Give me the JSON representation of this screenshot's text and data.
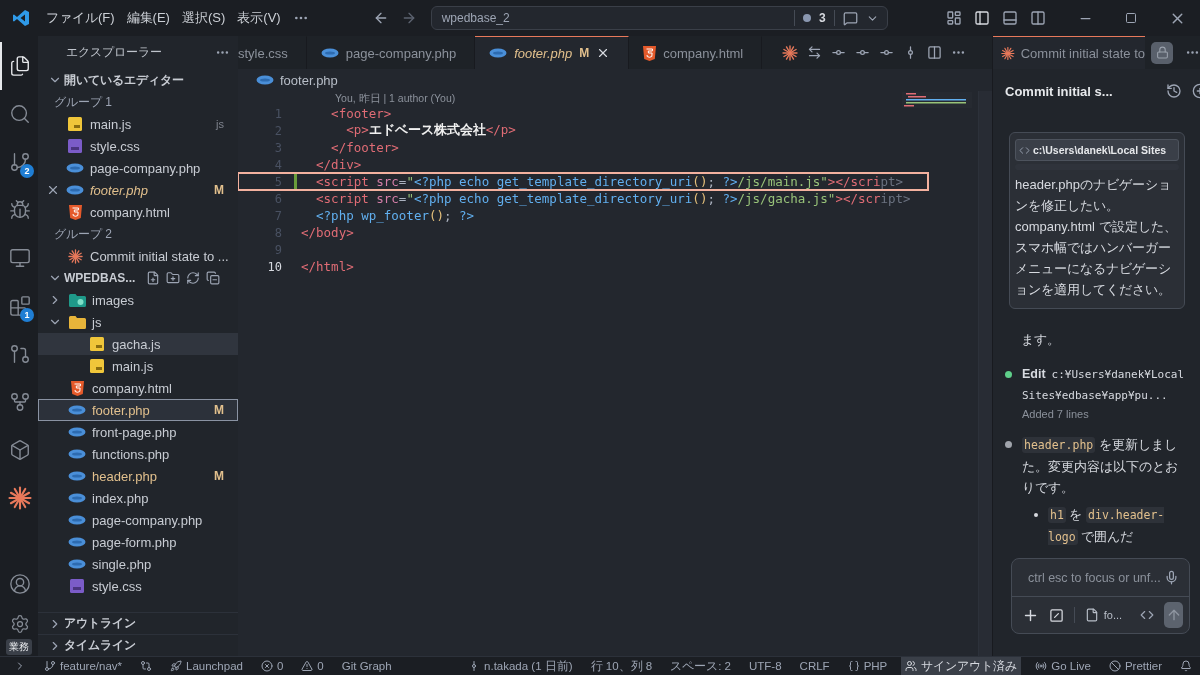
{
  "title_bar": {
    "menus": [
      "ファイル(F)",
      "編集(E)",
      "選択(S)",
      "表示(V)"
    ],
    "search": "wpedbase_2",
    "problems_count": "3"
  },
  "activity_bar": {
    "items": [
      {
        "kind": "files",
        "selected": true
      },
      {
        "kind": "search",
        "selected": false
      },
      {
        "kind": "source-control",
        "selected": false,
        "badge": "2"
      },
      {
        "kind": "run",
        "selected": false
      },
      {
        "kind": "remote",
        "selected": false
      },
      {
        "kind": "extensions",
        "selected": false,
        "badge": "1"
      },
      {
        "kind": "git",
        "selected": false
      },
      {
        "kind": "git-lens",
        "selected": false
      },
      {
        "kind": "package",
        "selected": false
      },
      {
        "kind": "spark",
        "selected": false
      }
    ],
    "settings": {
      "label": "業務"
    }
  },
  "sidebar": {
    "title": "エクスプローラー",
    "open_editors": {
      "title": "開いているエディター",
      "expanded": true,
      "groups": [
        {
          "title": "グループ 1",
          "files": [
            {
              "name": "main.js",
              "kind": "js",
              "description": "js",
              "active": false,
              "preview": false
            },
            {
              "name": "style.css",
              "kind": "css",
              "active": false,
              "preview": false
            },
            {
              "name": "page-company.php",
              "kind": "php",
              "active": false,
              "preview": false
            },
            {
              "name": "footer.php",
              "kind": "php",
              "active": true,
              "preview": true,
              "status": "M"
            },
            {
              "name": "company.html",
              "kind": "html",
              "active": false,
              "preview": false
            }
          ]
        },
        {
          "title": "グループ 2",
          "files": [
            {
              "name": "Commit initial state to ...",
              "kind": "spark",
              "active": false,
              "preview": false
            }
          ]
        }
      ]
    },
    "workspace": {
      "title": "WPEDBAS...",
      "expanded": true,
      "tree": [
        {
          "name": "images",
          "kind": "folder-images",
          "expanded": false,
          "selected": false,
          "hovered": false
        },
        {
          "name": "js",
          "kind": "folder",
          "expanded": true,
          "selected": false,
          "hovered": false,
          "children": [
            {
              "name": "gacha.js",
              "kind": "js",
              "selected": false,
              "hovered": true
            },
            {
              "name": "main.js",
              "kind": "js",
              "selected": false,
              "hovered": false
            }
          ]
        },
        {
          "name": "company.html",
          "kind": "html",
          "selected": false,
          "hovered": false
        },
        {
          "name": "footer.php",
          "kind": "php",
          "selected": true,
          "hovered": false,
          "status": "M"
        },
        {
          "name": "front-page.php",
          "kind": "php",
          "selected": false,
          "hovered": false
        },
        {
          "name": "functions.php",
          "kind": "php",
          "selected": false,
          "hovered": false
        },
        {
          "name": "header.php",
          "kind": "php",
          "selected": false,
          "hovered": false,
          "status": "M"
        },
        {
          "name": "index.php",
          "kind": "php",
          "selected": false,
          "hovered": false
        },
        {
          "name": "page-company.php",
          "kind": "php",
          "selected": false,
          "hovered": false
        },
        {
          "name": "page-form.php",
          "kind": "php",
          "selected": false,
          "hovered": false
        },
        {
          "name": "single.php",
          "kind": "php",
          "selected": false,
          "hovered": false
        },
        {
          "name": "style.css",
          "kind": "css",
          "selected": false,
          "hovered": false
        }
      ]
    },
    "sections": [
      {
        "title": "アウトライン",
        "expanded": false
      },
      {
        "title": "タイムライン",
        "expanded": false
      }
    ]
  },
  "tabs": [
    {
      "name": "style.css",
      "selected": false,
      "preview": false
    },
    {
      "name": "page-company.php",
      "kind": "php",
      "selected": false,
      "preview": false
    },
    {
      "name": "footer.php",
      "kind": "php",
      "selected": true,
      "preview": true,
      "status": "M"
    },
    {
      "name": "company.html",
      "kind": "html",
      "selected": false,
      "preview": false
    }
  ],
  "editor": {
    "breadcrumb": {
      "name": "footer.php",
      "kind": "php"
    },
    "codelens": "You, 昨日 | 1 author (You)",
    "lines": [
      {
        "number": "1",
        "current": false,
        "changed": false,
        "highlighted": false,
        "tokens": [
          {
            "kind": "tag",
            "t": "    <footer>"
          }
        ]
      },
      {
        "number": "2",
        "current": false,
        "changed": false,
        "highlighted": false,
        "tokens": [
          {
            "kind": "tag",
            "t": "      <p>"
          },
          {
            "kind": "text",
            "t": "エドベース株式会社"
          },
          {
            "kind": "tag",
            "t": "</p>"
          }
        ]
      },
      {
        "number": "3",
        "current": false,
        "changed": false,
        "highlighted": false,
        "tokens": [
          {
            "kind": "tag",
            "t": "    </footer>"
          }
        ]
      },
      {
        "number": "4",
        "current": false,
        "changed": false,
        "highlighted": false,
        "tokens": [
          {
            "kind": "tag",
            "t": "  </div>"
          }
        ]
      },
      {
        "number": "5",
        "current": false,
        "changed": true,
        "highlighted": true,
        "tokens": [
          {
            "kind": "tag",
            "t": "  <script"
          },
          {
            "kind": "attr",
            "t": " src"
          },
          {
            "kind": "punct",
            "t": "="
          },
          {
            "kind": "string",
            "t": "\""
          },
          {
            "kind": "php",
            "t": "<?php echo get_template_directory_uri"
          },
          {
            "kind": "paren",
            "t": "()"
          },
          {
            "kind": "punct",
            "t": "; "
          },
          {
            "kind": "php",
            "t": "?>"
          },
          {
            "kind": "string",
            "t": "/js/main.js\""
          },
          {
            "kind": "tag",
            "t": "></scri"
          },
          {
            "kind": "faded",
            "t": "pt>"
          }
        ]
      },
      {
        "number": "6",
        "current": false,
        "changed": false,
        "highlighted": false,
        "tokens": [
          {
            "kind": "tag",
            "t": "  <script"
          },
          {
            "kind": "attr",
            "t": " src"
          },
          {
            "kind": "punct",
            "t": "="
          },
          {
            "kind": "string",
            "t": "\""
          },
          {
            "kind": "php",
            "t": "<?php echo get_template_directory_uri"
          },
          {
            "kind": "paren",
            "t": "()"
          },
          {
            "kind": "punct",
            "t": "; "
          },
          {
            "kind": "php",
            "t": "?>"
          },
          {
            "kind": "string",
            "t": "/js/gacha.js\""
          },
          {
            "kind": "tag",
            "t": "></scr"
          },
          {
            "kind": "faded",
            "t": "ipt>"
          }
        ]
      },
      {
        "number": "7",
        "current": false,
        "changed": false,
        "highlighted": false,
        "tokens": [
          {
            "kind": "php",
            "t": "  <?php wp_footer"
          },
          {
            "kind": "paren",
            "t": "()"
          },
          {
            "kind": "punct",
            "t": "; "
          },
          {
            "kind": "php",
            "t": "?>"
          }
        ]
      },
      {
        "number": "8",
        "current": false,
        "changed": false,
        "highlighted": false,
        "tokens": [
          {
            "kind": "tag",
            "t": "</body>"
          }
        ]
      },
      {
        "number": "9",
        "current": false,
        "changed": false,
        "highlighted": false
      },
      {
        "number": "10",
        "current": true,
        "changed": false,
        "highlighted": false,
        "tokens": [
          {
            "kind": "tag",
            "t": "</html>"
          }
        ]
      }
    ]
  },
  "chat": {
    "tab": "Commit initial state to",
    "title": "Commit initial s...",
    "prompt": {
      "path": "c:\\Users\\danek\\Local Sites",
      "text": "header.phpのナビゲーションを修正したい。company.html で設定した、スマホ幅ではハンバーガーメニューになるナビゲーションを適用してください。"
    },
    "messages": [
      {
        "kind": "plain",
        "parts": [
          {
            "code": false,
            "t": "ます。"
          }
        ]
      },
      {
        "kind": "tool",
        "color": "#5fcf8a",
        "label": "Edit",
        "path": "c:¥Users¥danek¥Local Sites¥edbase¥app¥pu...",
        "detail": "Added 7 lines"
      },
      {
        "kind": "bullet",
        "color": "#a0a4ab",
        "parts": [
          {
            "code": true,
            "t": "header.php"
          },
          {
            "code": false,
            "t": " を更新しました。変更内容は以下のとおりです。"
          }
        ],
        "children": [
          {
            "parts": [
              {
                "code": true,
                "t": "h1"
              },
              {
                "code": false,
                "t": " を "
              },
              {
                "code": true,
                "t": "div.header-logo"
              },
              {
                "code": false,
                "t": " で囲んだ"
              }
            ]
          }
        ]
      }
    ],
    "input": {
      "placeholder": "ctrl esc to focus or unf...",
      "attachment": "fo..."
    }
  },
  "status_bar": {
    "left": [
      {
        "kind": "remote"
      },
      {
        "kind": "branch",
        "text": "feature/nav*"
      },
      {
        "kind": "compare"
      },
      {
        "kind": "launchpad",
        "text": "Launchpad"
      },
      {
        "kind": "errors",
        "text": "0"
      },
      {
        "kind": "warnings",
        "text": "0"
      },
      {
        "kind": "plain",
        "text": "Git Graph"
      }
    ],
    "right": [
      {
        "kind": "blame",
        "text": "n.takada (1 日前)"
      },
      {
        "kind": "plain",
        "text": "行 10、列 8"
      },
      {
        "kind": "plain",
        "text": "スペース: 2"
      },
      {
        "kind": "plain",
        "text": "UTF-8"
      },
      {
        "kind": "plain",
        "text": "CRLF"
      },
      {
        "kind": "language",
        "text": "PHP"
      },
      {
        "kind": "account",
        "text": "サインアウト済み"
      },
      {
        "kind": "live",
        "text": "Go Live"
      },
      {
        "kind": "prettier",
        "text": "Prettier"
      },
      {
        "kind": "bell"
      }
    ]
  }
}
